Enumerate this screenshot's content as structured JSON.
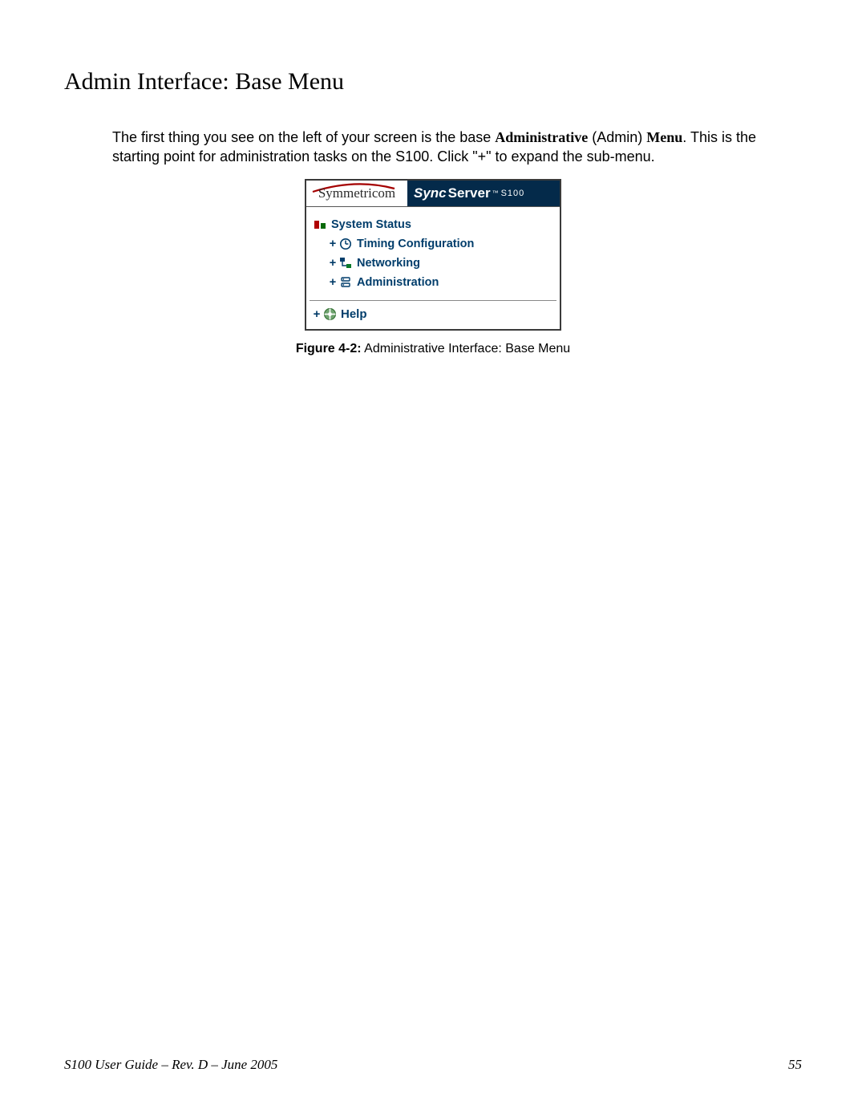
{
  "heading": "Admin Interface: Base Menu",
  "paragraph": {
    "part1": "The first thing you see on the left of your screen is the base ",
    "bold1": "Administrative",
    "part2": " (Admin) ",
    "bold2": "Menu",
    "part3": ". This is the starting point for administration tasks on the S100. Click \"+\" to expand the sub-menu."
  },
  "figure": {
    "label": "Figure 4-2:",
    "caption": "  Administrative Interface: Base Menu"
  },
  "screenshot": {
    "brand": "Symmetricom",
    "product_sync": "Sync",
    "product_server": "Server",
    "product_tm": "™",
    "product_model": "S100",
    "menu": {
      "system_status": "System Status",
      "timing_config": "Timing Configuration",
      "networking": "Networking",
      "administration": "Administration",
      "help": "Help"
    },
    "plus": "+"
  },
  "footer": {
    "left": "S100 User Guide – Rev. D – June 2005",
    "right": "55"
  }
}
